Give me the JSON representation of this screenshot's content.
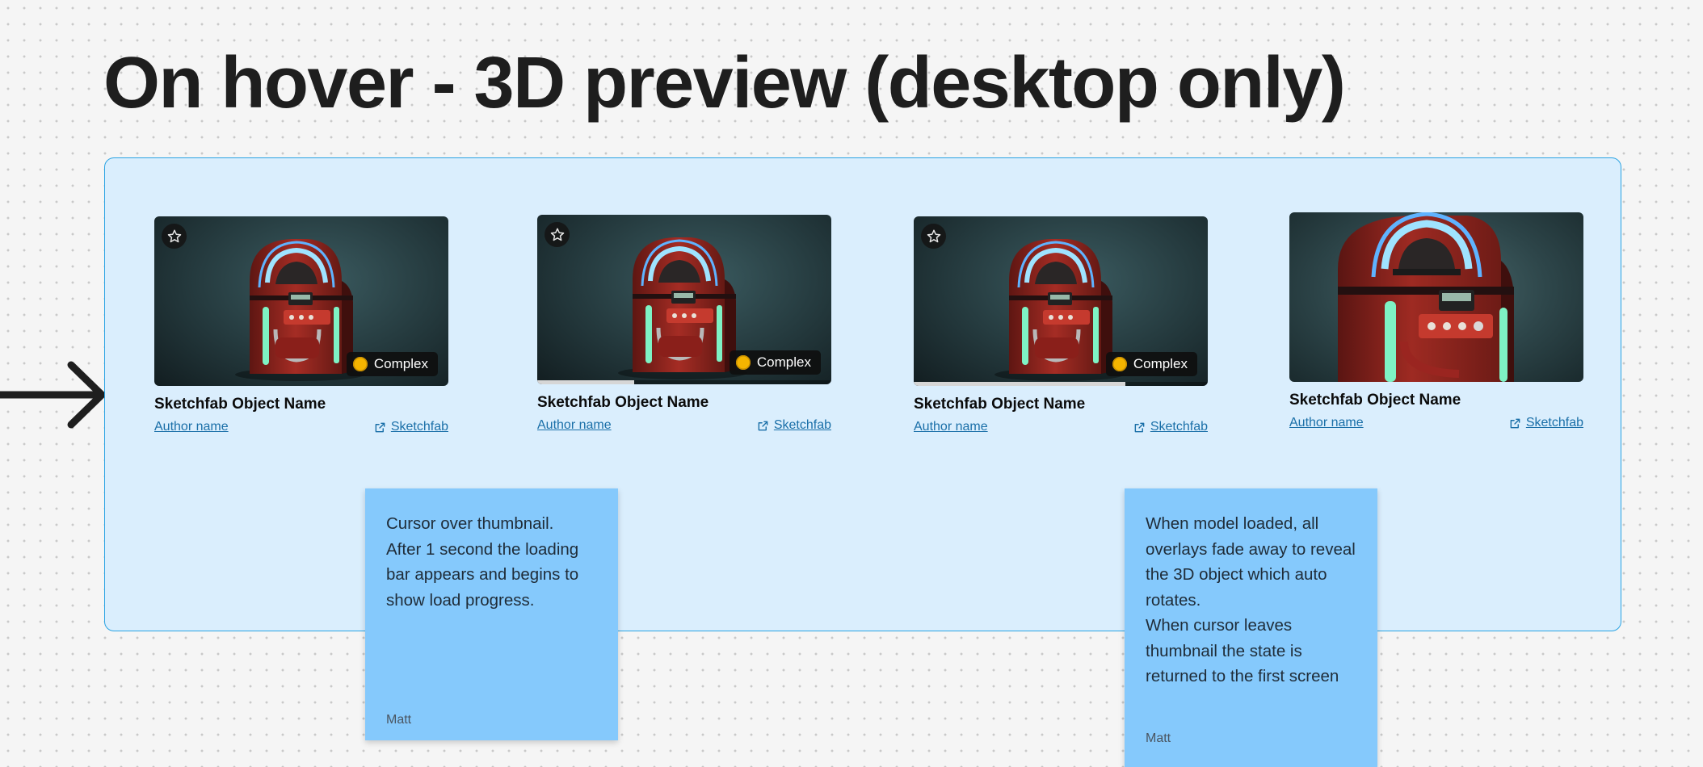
{
  "page": {
    "title": "On hover - 3D preview (desktop only)"
  },
  "cards": [
    {
      "star_icon": "star-outline-icon",
      "badge": "Complex",
      "badge_color": "#f4b400",
      "title": "Sketchfab Object Name",
      "author": "Author name",
      "source_icon": "external-link-icon",
      "source": "Sketchfab",
      "load_progress": null
    },
    {
      "star_icon": "star-outline-icon",
      "badge": "Complex",
      "badge_color": "#f4b400",
      "title": "Sketchfab Object Name",
      "author": "Author name",
      "source_icon": "external-link-icon",
      "source": "Sketchfab",
      "load_progress": 0.33
    },
    {
      "star_icon": "star-outline-icon",
      "badge": "Complex",
      "badge_color": "#f4b400",
      "title": "Sketchfab Object Name",
      "author": "Author name",
      "source_icon": "external-link-icon",
      "source": "Sketchfab",
      "load_progress": 0.72
    },
    {
      "title": "Sketchfab Object Name",
      "author": "Author name",
      "source_icon": "external-link-icon",
      "source": "Sketchfab"
    }
  ],
  "notes": [
    {
      "text": "Cursor over thumbnail.\nAfter 1 second the loading bar appears and begins to show load progress.",
      "author": "Matt"
    },
    {
      "text": "When model loaded, all overlays fade away to reveal the 3D object which auto rotates.\nWhen cursor leaves thumbnail the state is returned to the first screen",
      "author": "Matt"
    }
  ],
  "colors": {
    "frame_background": "#daeefd",
    "frame_border": "#2aa3e3",
    "sticky_note": "#85c9fc",
    "link": "#1a6fa8"
  }
}
